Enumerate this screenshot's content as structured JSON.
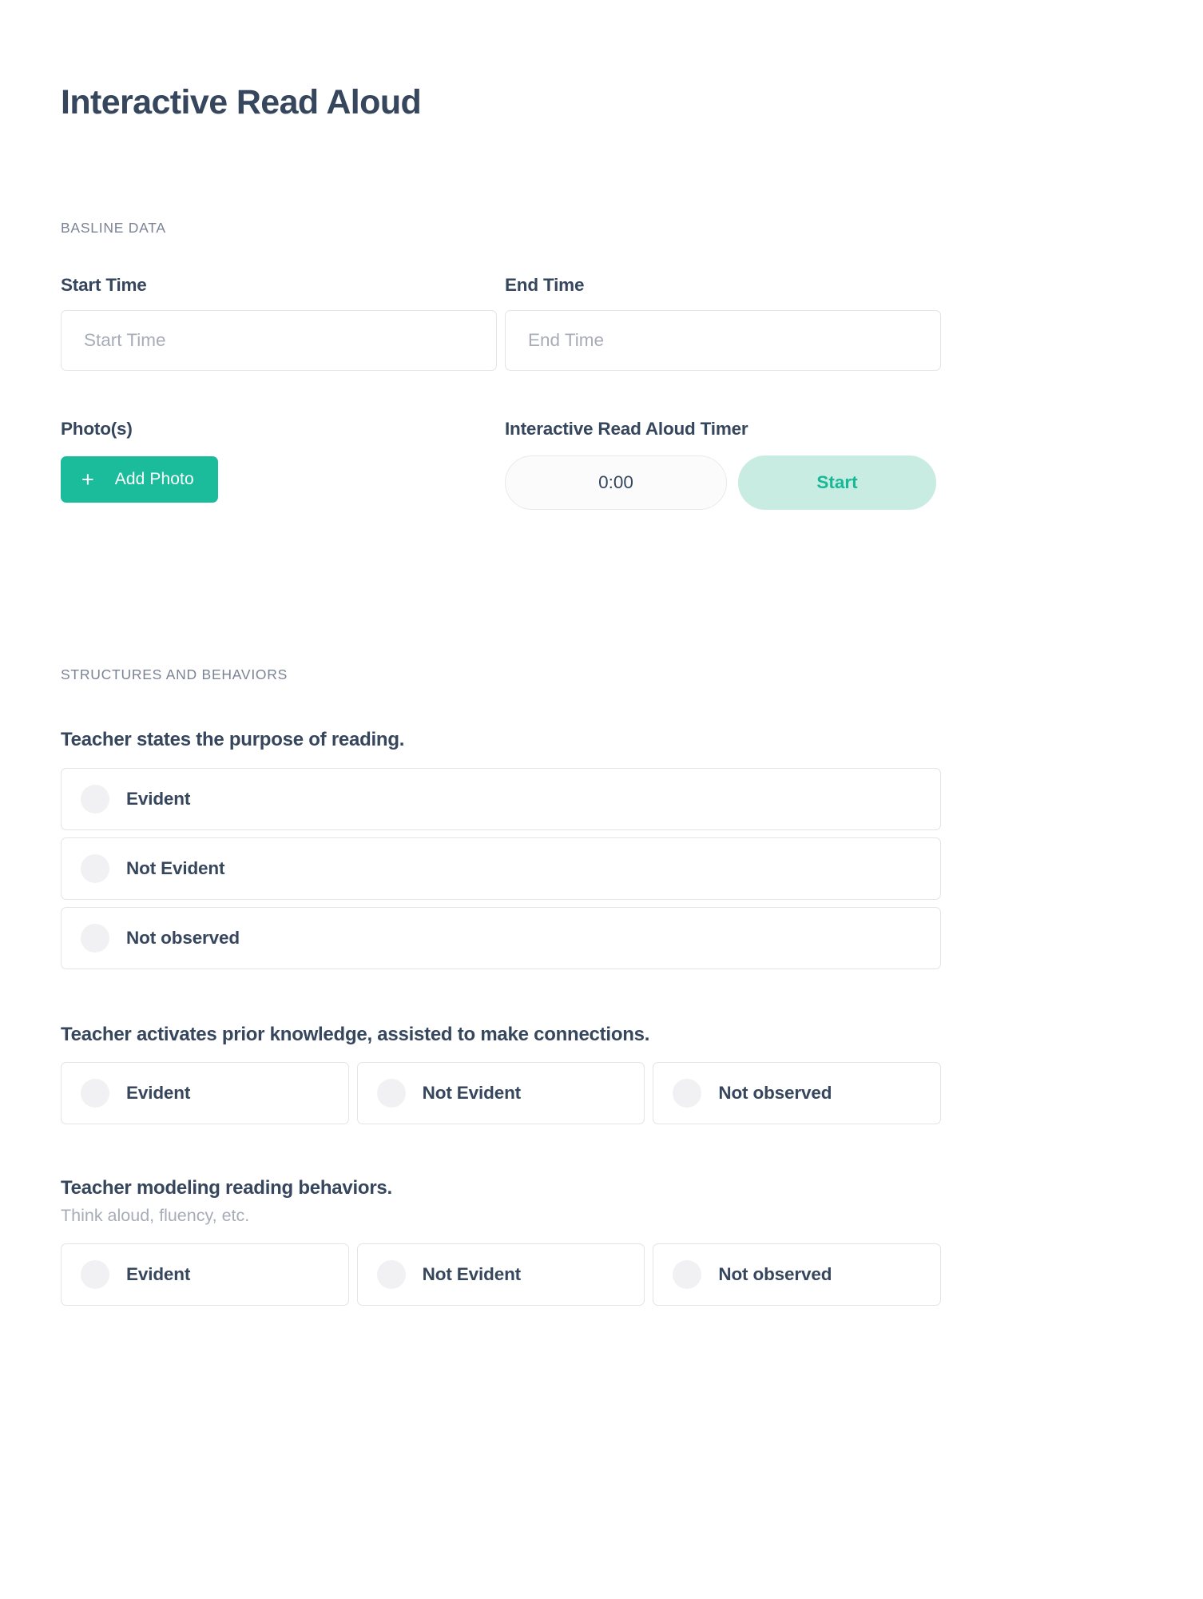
{
  "page": {
    "title": "Interactive Read Aloud"
  },
  "sections": {
    "baseline": {
      "label": "BASLINE DATA",
      "start_time": {
        "label": "Start Time",
        "placeholder": "Start Time",
        "value": ""
      },
      "end_time": {
        "label": "End Time",
        "placeholder": "End Time",
        "value": ""
      },
      "photos": {
        "label": "Photo(s)",
        "add_button_label": "Add Photo",
        "add_button_icon": "plus-icon"
      },
      "timer": {
        "label": "Interactive Read Aloud Timer",
        "display_value": "0:00",
        "start_button_label": "Start"
      }
    },
    "structures": {
      "label": "STRUCTURES AND BEHAVIORS",
      "questions": [
        {
          "title": "Teacher states the purpose of reading.",
          "subtitle": "",
          "layout": "stacked",
          "options": [
            {
              "label": "Evident",
              "selected": false
            },
            {
              "label": "Not Evident",
              "selected": false
            },
            {
              "label": "Not observed",
              "selected": false
            }
          ]
        },
        {
          "title": "Teacher activates prior knowledge, assisted to make connections.",
          "subtitle": "",
          "layout": "grid",
          "options": [
            {
              "label": "Evident",
              "selected": false
            },
            {
              "label": "Not Evident",
              "selected": false
            },
            {
              "label": "Not observed",
              "selected": false
            }
          ]
        },
        {
          "title": "Teacher modeling reading behaviors.",
          "subtitle": "Think aloud, fluency, etc.",
          "layout": "grid",
          "options": [
            {
              "label": "Evident",
              "selected": false
            },
            {
              "label": "Not Evident",
              "selected": false
            },
            {
              "label": "Not observed",
              "selected": false
            }
          ]
        }
      ]
    }
  },
  "colors": {
    "accent_green": "#1abc9c",
    "accent_green_soft": "#c8ece1",
    "accent_green_text": "#17b897",
    "heading_navy": "#36465d",
    "muted_gray": "#a7acb8",
    "label_gray": "#7a8394",
    "border_gray": "#e4e4e6",
    "radio_fill": "#f1f1f3"
  }
}
